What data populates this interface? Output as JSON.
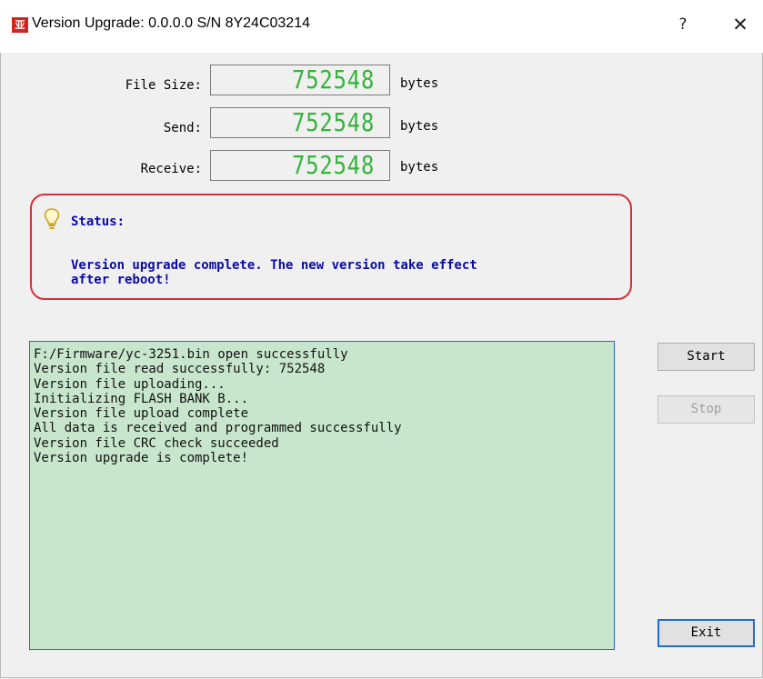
{
  "window": {
    "title": "Version Upgrade: 0.0.0.0  S/N 8Y24C03214",
    "app_icon_glyph": "亚",
    "help_label": "?",
    "close_label": "✕",
    "app_icon_color": "#d0261d"
  },
  "counters": [
    {
      "label": "File Size:",
      "value": "752548",
      "unit": "bytes"
    },
    {
      "label": "Send:",
      "value": "752548",
      "unit": "bytes"
    },
    {
      "label": "Receive:",
      "value": "752548",
      "unit": "bytes"
    }
  ],
  "status": {
    "title": "Status:",
    "message": "Version upgrade complete. The new version take effect\nafter reboot!",
    "icon": "lightbulb-icon",
    "border_color": "#d62f3a",
    "text_color": "#0a0aa8"
  },
  "log": {
    "lines": [
      "F:/Firmware/yc-3251.bin open successfully",
      "Version file read successfully: 752548",
      "Version file uploading...",
      "Initializing FLASH BANK B...",
      "Version file upload complete",
      "All data is received and programmed successfully",
      "Version file CRC check succeeded",
      "Version upgrade is complete!"
    ],
    "background": "#c8e6cc"
  },
  "buttons": {
    "start": "Start",
    "stop": "Stop",
    "exit": "Exit"
  },
  "colors": {
    "led_digits": "#34b43c",
    "focus_border": "#1f6bd1"
  }
}
